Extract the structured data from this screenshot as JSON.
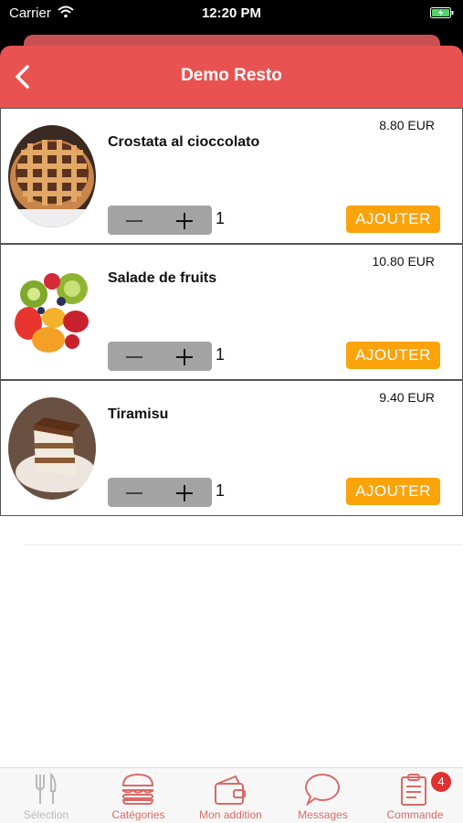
{
  "status_bar": {
    "carrier": "Carrier",
    "time": "12:20 PM"
  },
  "header": {
    "title": "Demo Resto"
  },
  "items": [
    {
      "name": "Crostata al cioccolato",
      "price": "8.80 EUR",
      "quantity": "1",
      "add_label": "AJOUTER"
    },
    {
      "name": "Salade de fruits",
      "price": "10.80 EUR",
      "quantity": "1",
      "add_label": "AJOUTER"
    },
    {
      "name": "Tiramisu",
      "price": "9.40 EUR",
      "quantity": "1",
      "add_label": "AJOUTER"
    }
  ],
  "tabs": [
    {
      "label": "Sélection",
      "icon": "fork-knife-icon",
      "enabled": false
    },
    {
      "label": "Catégories",
      "icon": "burger-icon",
      "enabled": true
    },
    {
      "label": "Mon addition",
      "icon": "wallet-icon",
      "enabled": true
    },
    {
      "label": "Messages",
      "icon": "chat-bubble-icon",
      "enabled": true
    },
    {
      "label": "Commande",
      "icon": "clipboard-icon",
      "enabled": true,
      "badge": "4"
    }
  ],
  "colors": {
    "header": "#e85352",
    "add_button": "#fba30a",
    "stepper": "#a3a3a3",
    "tab_active": "#d96a68",
    "badge": "#e03030"
  }
}
